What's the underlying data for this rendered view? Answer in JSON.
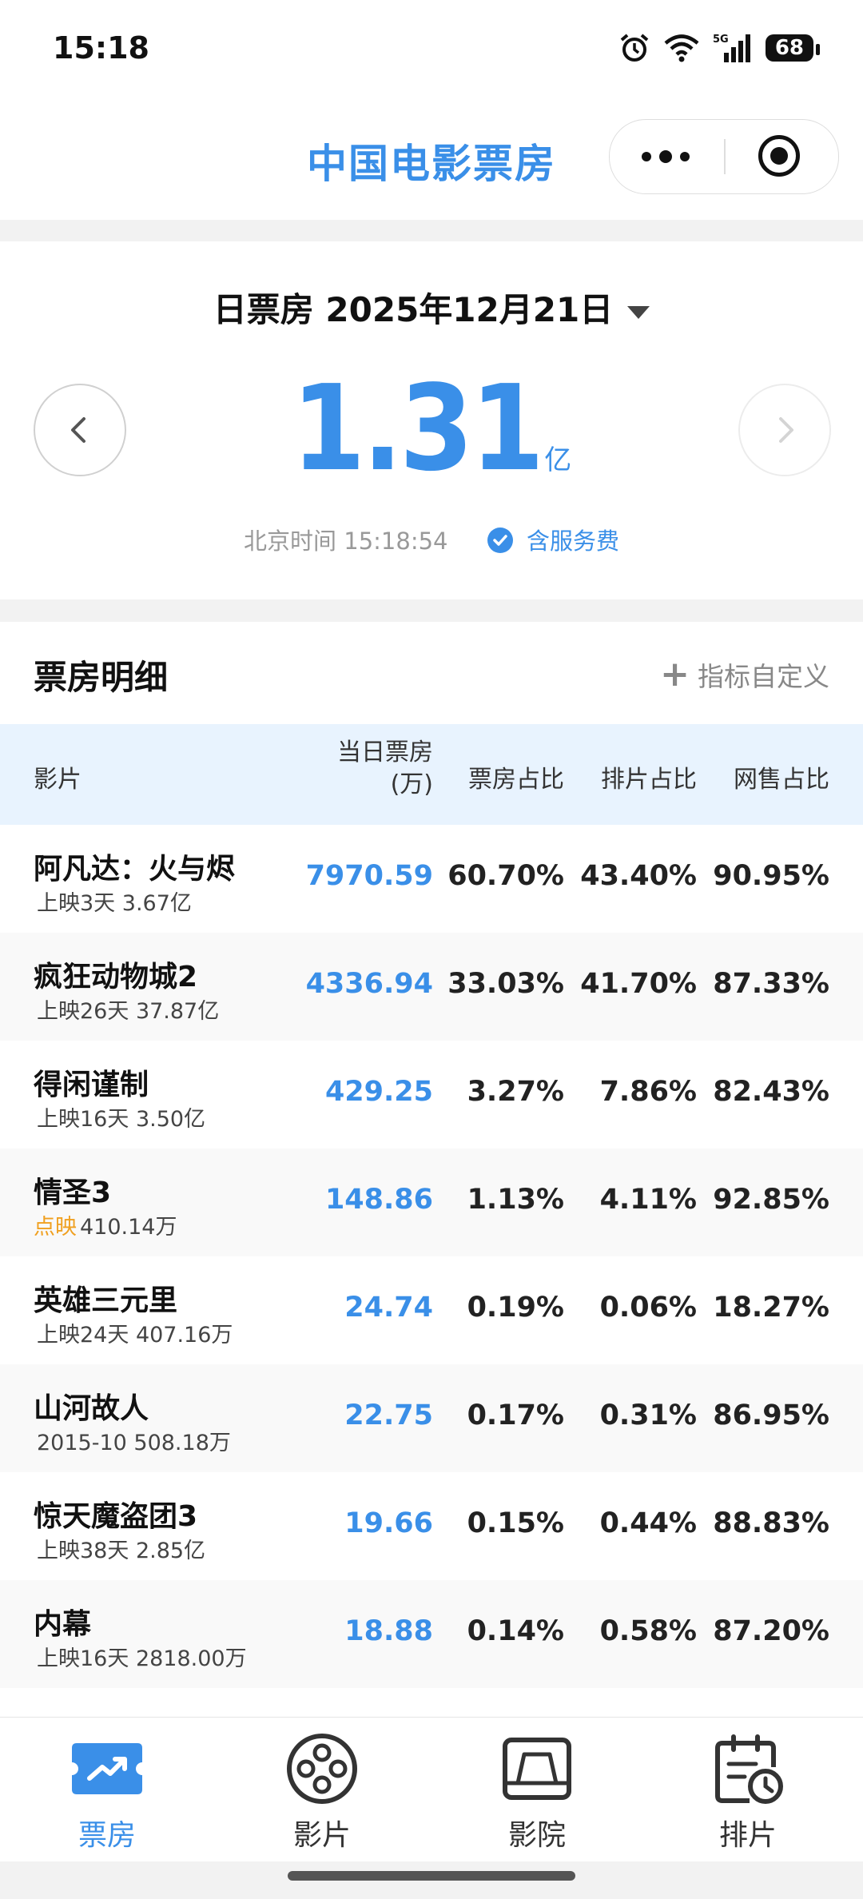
{
  "status_bar": {
    "time": "15:18",
    "battery": "68"
  },
  "nav": {
    "title": "中国电影票房"
  },
  "summary": {
    "date_label": "日票房 2025年12月21日",
    "total_value": "1.31",
    "total_unit": "亿",
    "beijing_time": "北京时间 15:18:54",
    "service_fee": "含服务费"
  },
  "detail": {
    "title": "票房明细",
    "customize_label": "指标自定义",
    "columns": {
      "film": "影片",
      "box_line1": "当日票房",
      "box_line2": "(万)",
      "box_share": "票房占比",
      "screen_share": "排片占比",
      "online_share": "网售占比"
    },
    "rows": [
      {
        "name": "阿凡达：火与烬",
        "tag": "",
        "sub": "上映3天 3.67亿",
        "box": "7970.59",
        "box_share": "60.70%",
        "screen_share": "43.40%",
        "online_share": "90.95%"
      },
      {
        "name": "疯狂动物城2",
        "tag": "",
        "sub": "上映26天 37.87亿",
        "box": "4336.94",
        "box_share": "33.03%",
        "screen_share": "41.70%",
        "online_share": "87.33%"
      },
      {
        "name": "得闲谨制",
        "tag": "",
        "sub": "上映16天 3.50亿",
        "box": "429.25",
        "box_share": "3.27%",
        "screen_share": "7.86%",
        "online_share": "82.43%"
      },
      {
        "name": "情圣3",
        "tag": "点映",
        "sub": "410.14万",
        "box": "148.86",
        "box_share": "1.13%",
        "screen_share": "4.11%",
        "online_share": "92.85%"
      },
      {
        "name": "英雄三元里",
        "tag": "",
        "sub": "上映24天 407.16万",
        "box": "24.74",
        "box_share": "0.19%",
        "screen_share": "0.06%",
        "online_share": "18.27%"
      },
      {
        "name": "山河故人",
        "tag": "",
        "sub": "2015-10 508.18万",
        "box": "22.75",
        "box_share": "0.17%",
        "screen_share": "0.31%",
        "online_share": "86.95%"
      },
      {
        "name": "惊天魔盗团3",
        "tag": "",
        "sub": "上映38天 2.85亿",
        "box": "19.66",
        "box_share": "0.15%",
        "screen_share": "0.44%",
        "online_share": "88.83%"
      },
      {
        "name": "内幕",
        "tag": "",
        "sub": "上映16天 2818.00万",
        "box": "18.88",
        "box_share": "0.14%",
        "screen_share": "0.58%",
        "online_share": "87.20%"
      }
    ]
  },
  "tabs": [
    {
      "label": "票房",
      "icon": "box-office-trend-icon",
      "active": true
    },
    {
      "label": "影片",
      "icon": "film-reel-icon",
      "active": false
    },
    {
      "label": "影院",
      "icon": "cinema-screen-icon",
      "active": false
    },
    {
      "label": "排片",
      "icon": "schedule-calendar-icon",
      "active": false
    }
  ],
  "colors": {
    "accent": "#3a8fe8",
    "header_bg": "#e8f3fe",
    "tag_orange": "#f0a020"
  }
}
